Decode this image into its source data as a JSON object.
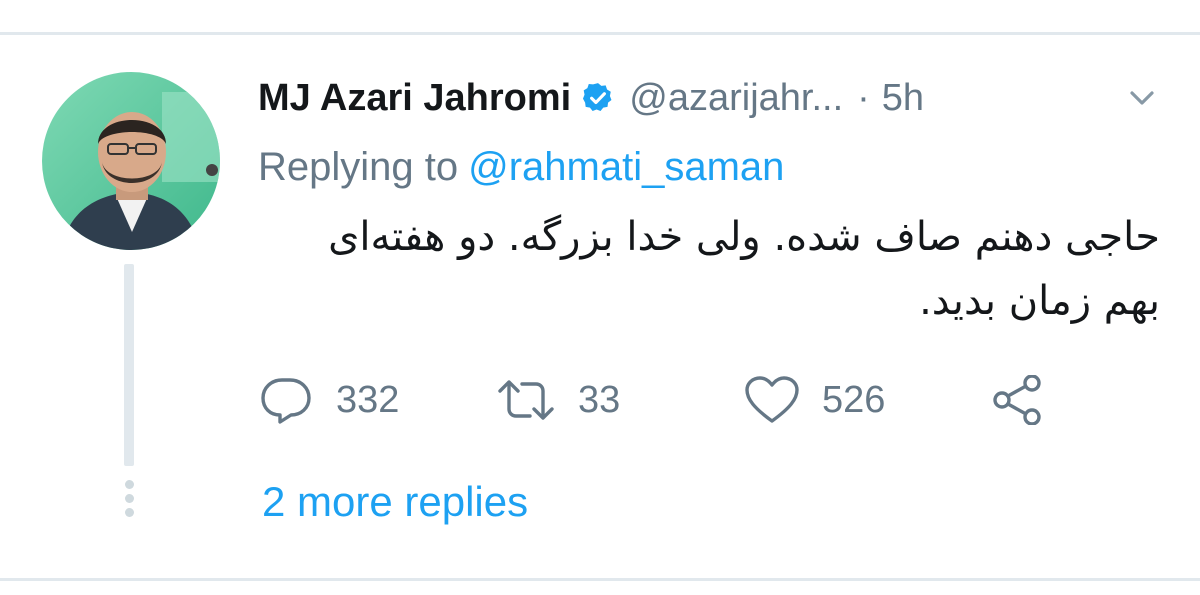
{
  "tweet": {
    "author_name": "MJ Azari Jahromi",
    "handle": "@azarijahr...",
    "separator": "·",
    "time": "5h",
    "replying_prefix": "Replying to",
    "replying_to": "@rahmati_saman",
    "text": "حاجی دهنم صاف شده. ولی خدا بزرگه. دو هفته‌ای بهم زمان بدید."
  },
  "actions": {
    "replies": "332",
    "retweets": "33",
    "likes": "526"
  },
  "thread": {
    "more_replies": "2 more replies"
  },
  "icons": {
    "verified": "verified-badge-icon",
    "caret": "chevron-down-icon",
    "reply": "reply-icon",
    "retweet": "retweet-icon",
    "like": "heart-icon",
    "share": "share-icon"
  },
  "colors": {
    "accent": "#1da1f2",
    "text": "#14171a",
    "secondary": "#657786",
    "divider": "#e1e8ed"
  }
}
